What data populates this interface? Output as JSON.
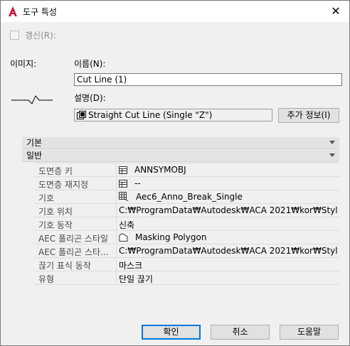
{
  "window": {
    "title": "도구 특성",
    "close_glyph": "✕",
    "app_icon": "autocad-a-icon"
  },
  "refresh_checkbox": {
    "label": "갱신(R):",
    "checked": false,
    "enabled": false
  },
  "image_label": "이미지:",
  "name": {
    "label": "이름(N):",
    "value": "Cut Line (1)"
  },
  "description": {
    "label": "설명(D):",
    "value": "Straight Cut Line (Single \"Z\")",
    "icon": "description-edit-icon"
  },
  "more_info_button": "추가 정보(I)",
  "sections": {
    "basic": {
      "title": "기본"
    },
    "general": {
      "title": "일반"
    }
  },
  "properties": [
    {
      "key": "도면층 키",
      "value": "ANNSYMOBJ",
      "icon": "table-icon"
    },
    {
      "key": "도면층 재지정",
      "value": "--",
      "icon": "table-icon"
    },
    {
      "key": "기호",
      "value": "Aec6_Anno_Break_Single",
      "icon": "symbol-grid-icon"
    },
    {
      "key": "기호 위치",
      "value": "C:₩ProgramData₩Autodesk₩ACA  2021₩kor₩Styles...",
      "icon": ""
    },
    {
      "key": "기호 동작",
      "value": "신축",
      "icon": ""
    },
    {
      "key": "AEC 폴리곤 스타일",
      "value": "Masking Polygon",
      "icon": "polygon-icon"
    },
    {
      "key": "AEC 폴리곤 스타...",
      "value": "C:₩ProgramData₩Autodesk₩ACA  2021₩kor₩Styles...",
      "icon": ""
    },
    {
      "key": "끊기 표식 동작",
      "value": "마스크",
      "icon": ""
    },
    {
      "key": "유형",
      "value": "단일 끊기",
      "icon": ""
    }
  ],
  "buttons": {
    "ok": "확인",
    "cancel": "취소",
    "help": "도움말"
  },
  "colors": {
    "accent": "#0078d7",
    "app_icon_red": "#c8102e"
  }
}
